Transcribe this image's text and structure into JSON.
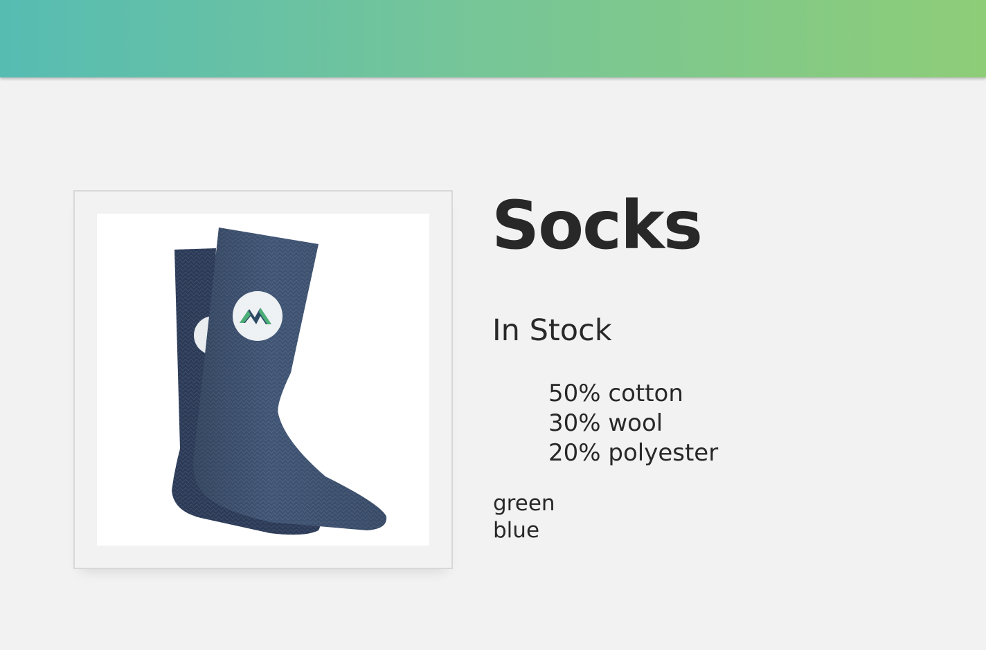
{
  "product": {
    "title": "Socks",
    "stock_status": "In Stock",
    "details": [
      "50% cotton",
      "30% wool",
      "20% polyester"
    ],
    "variants": [
      "green",
      "blue"
    ]
  },
  "theme": {
    "nav_gradient_start": "#56bcb2",
    "nav_gradient_end": "#8ecd78",
    "background": "#f2f2f2",
    "text": "#282828",
    "sock_color": "#3d4f6e",
    "sock_color_back": "#2b3a57",
    "logo_green": "#4caf78",
    "logo_dark": "#2c4a63"
  }
}
